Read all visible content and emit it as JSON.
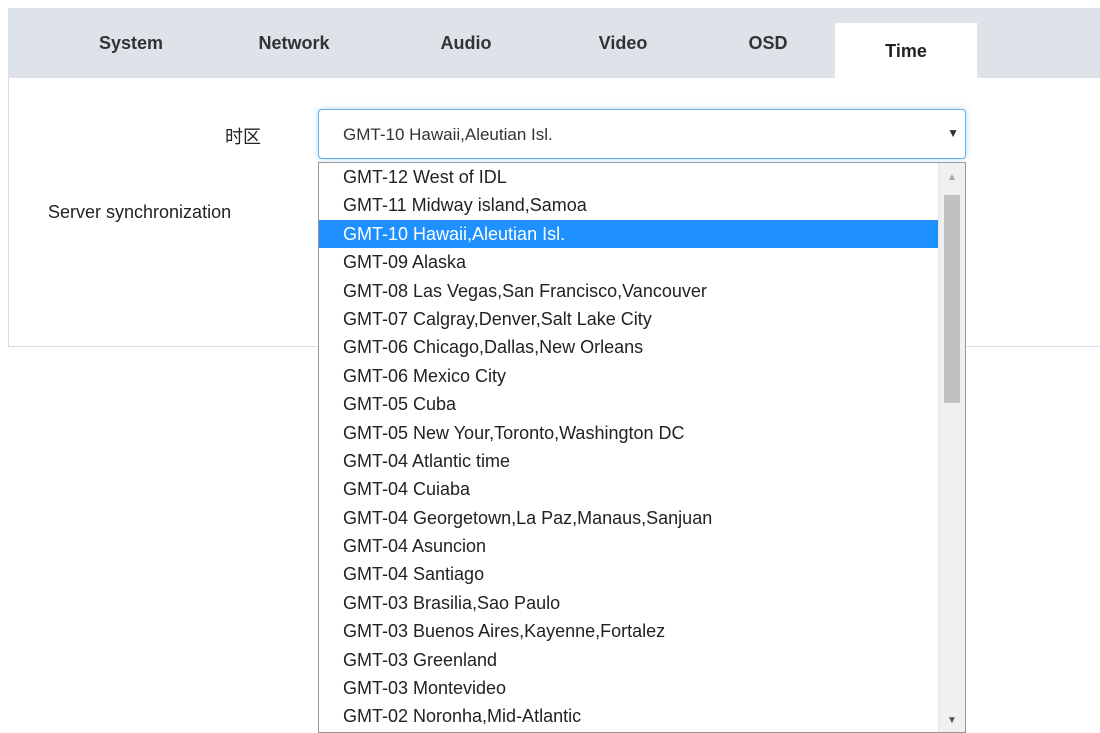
{
  "tabs": [
    {
      "label": "System",
      "active": false
    },
    {
      "label": "Network",
      "active": false
    },
    {
      "label": "Audio",
      "active": false
    },
    {
      "label": "Video",
      "active": false
    },
    {
      "label": "OSD",
      "active": false
    },
    {
      "label": "Time",
      "active": true
    }
  ],
  "form": {
    "timezone_label": "时区",
    "server_sync_label": "Server synchronization"
  },
  "timezone_select": {
    "selected_value": "GMT-10 Hawaii,Aleutian Isl.",
    "options": [
      "GMT-12 West of IDL",
      "GMT-11 Midway island,Samoa",
      "GMT-10 Hawaii,Aleutian Isl.",
      "GMT-09 Alaska",
      "GMT-08 Las Vegas,San Francisco,Vancouver",
      "GMT-07 Calgray,Denver,Salt Lake City",
      "GMT-06 Chicago,Dallas,New Orleans",
      "GMT-06 Mexico City",
      "GMT-05 Cuba",
      "GMT-05 New Your,Toronto,Washington DC",
      "GMT-04 Atlantic time",
      "GMT-04 Cuiaba",
      "GMT-04 Georgetown,La Paz,Manaus,Sanjuan",
      "GMT-04 Asuncion",
      "GMT-04 Santiago",
      "GMT-03 Brasilia,Sao Paulo",
      "GMT-03 Buenos Aires,Kayenne,Fortalez",
      "GMT-03 Greenland",
      "GMT-03 Montevideo",
      "GMT-02 Noronha,Mid-Atlantic"
    ],
    "highlighted_index": 2
  },
  "icons": {
    "dropdown_arrow": "caret-down-icon",
    "scroll_up": "scroll-up-arrow-icon",
    "scroll_down": "scroll-down-arrow-icon"
  },
  "colors": {
    "tabbar_bg": "#dde3e9",
    "highlight": "#1e90ff",
    "focus_border": "#66afe9"
  }
}
